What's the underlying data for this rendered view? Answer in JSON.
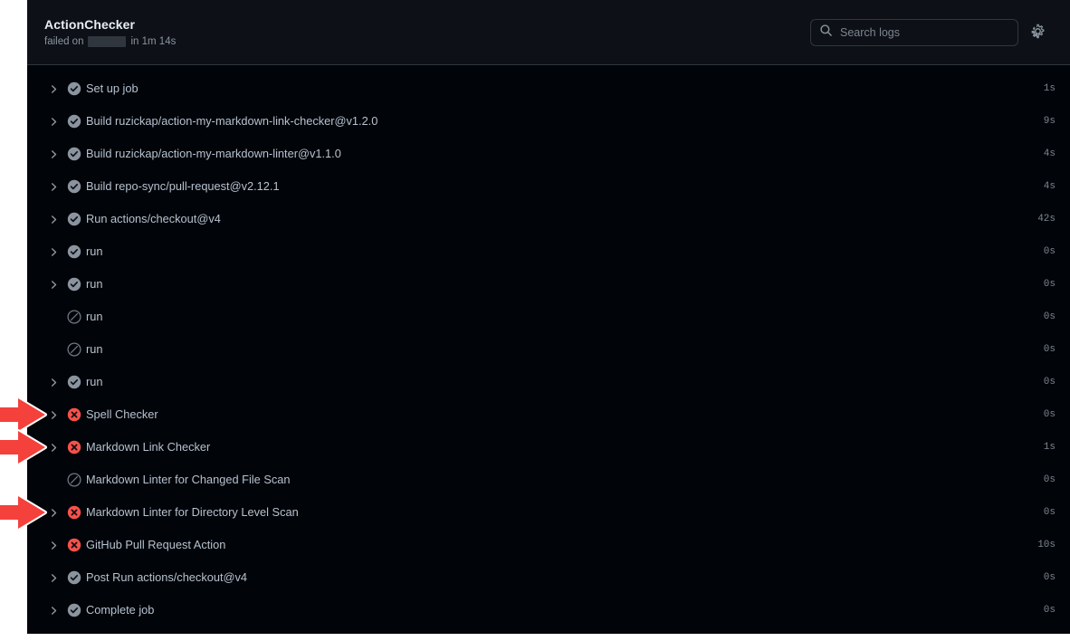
{
  "header": {
    "job_title": "ActionChecker",
    "status_prefix": "failed on",
    "redacted_label": "",
    "duration_text": "in 1m 14s",
    "search_placeholder": "Search logs",
    "search_value": "",
    "search_icon": "search-icon",
    "settings_icon": "gear-icon"
  },
  "colors": {
    "background": "#010409",
    "header_background": "#0d1117",
    "border": "#30363d",
    "text_primary": "#e6edf3",
    "text_secondary": "#8b949e",
    "step_label": "#b6c2cf",
    "success_icon": "#8b949e",
    "failure_icon": "#f85149",
    "skipped_icon": "#6e7681",
    "annotation_arrow": "#f4413c"
  },
  "steps": [
    {
      "label": "Set up job",
      "status": "success",
      "duration": "1s",
      "expandable": true,
      "annotated": false
    },
    {
      "label": "Build ruzickap/action-my-markdown-link-checker@v1.2.0",
      "status": "success",
      "duration": "9s",
      "expandable": true,
      "annotated": false
    },
    {
      "label": "Build ruzickap/action-my-markdown-linter@v1.1.0",
      "status": "success",
      "duration": "4s",
      "expandable": true,
      "annotated": false
    },
    {
      "label": "Build repo-sync/pull-request@v2.12.1",
      "status": "success",
      "duration": "4s",
      "expandable": true,
      "annotated": false
    },
    {
      "label": "Run actions/checkout@v4",
      "status": "success",
      "duration": "42s",
      "expandable": true,
      "annotated": false
    },
    {
      "label": "run",
      "status": "success",
      "duration": "0s",
      "expandable": true,
      "annotated": false
    },
    {
      "label": "run",
      "status": "success",
      "duration": "0s",
      "expandable": true,
      "annotated": false
    },
    {
      "label": "run",
      "status": "skipped",
      "duration": "0s",
      "expandable": false,
      "annotated": false
    },
    {
      "label": "run",
      "status": "skipped",
      "duration": "0s",
      "expandable": false,
      "annotated": false
    },
    {
      "label": "run",
      "status": "success",
      "duration": "0s",
      "expandable": true,
      "annotated": false
    },
    {
      "label": "Spell Checker",
      "status": "failure",
      "duration": "0s",
      "expandable": true,
      "annotated": true
    },
    {
      "label": "Markdown Link Checker",
      "status": "failure",
      "duration": "1s",
      "expandable": true,
      "annotated": true
    },
    {
      "label": "Markdown Linter for Changed File Scan",
      "status": "skipped",
      "duration": "0s",
      "expandable": false,
      "annotated": false
    },
    {
      "label": "Markdown Linter for Directory Level Scan",
      "status": "failure",
      "duration": "0s",
      "expandable": true,
      "annotated": true
    },
    {
      "label": "GitHub Pull Request Action",
      "status": "failure",
      "duration": "10s",
      "expandable": true,
      "annotated": false
    },
    {
      "label": "Post Run actions/checkout@v4",
      "status": "success",
      "duration": "0s",
      "expandable": true,
      "annotated": false
    },
    {
      "label": "Complete job",
      "status": "success",
      "duration": "0s",
      "expandable": true,
      "annotated": false
    }
  ]
}
